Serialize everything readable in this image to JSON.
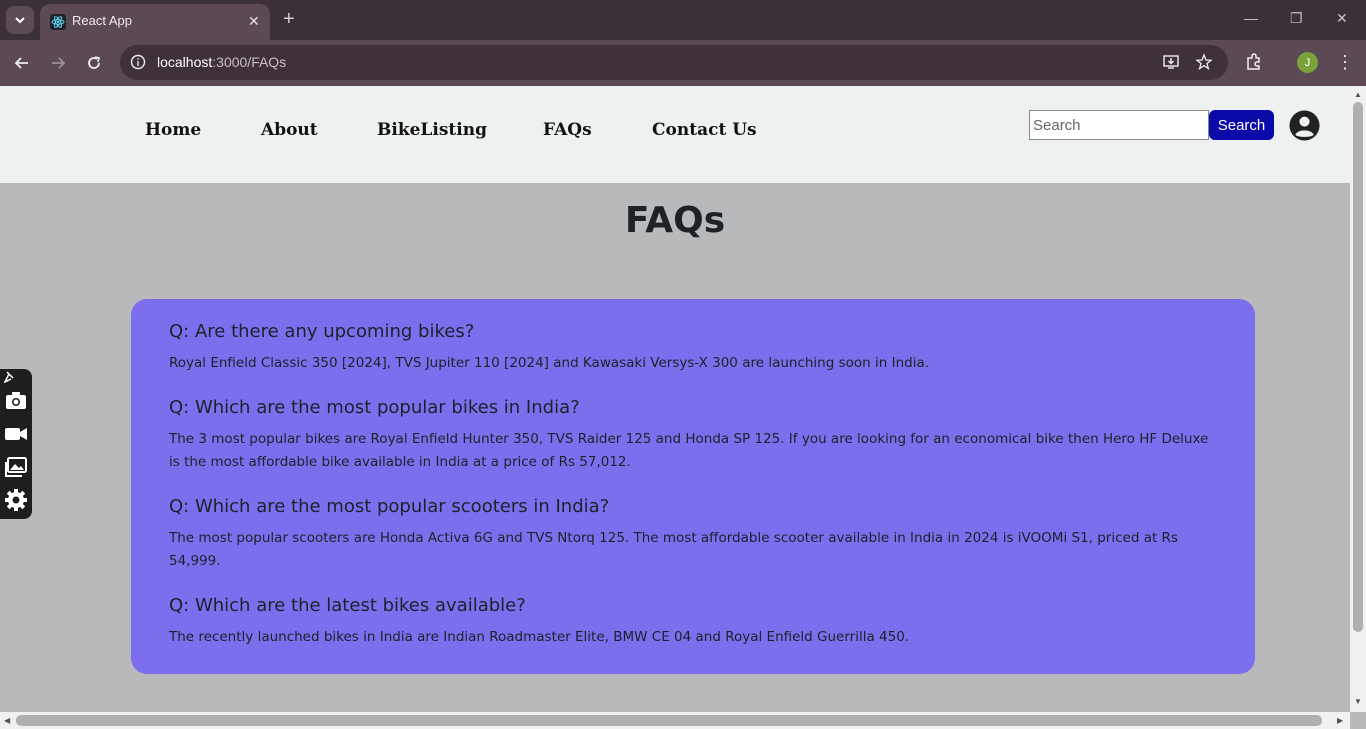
{
  "browser": {
    "tab_title": "React App",
    "url_host": "localhost",
    "url_path": ":3000/FAQs",
    "profile_initial": "J"
  },
  "navbar": {
    "links": [
      "Home",
      "About",
      "BikeListing",
      "FAQs",
      "Contact Us"
    ],
    "search_placeholder": "Search",
    "search_button": "Search"
  },
  "page": {
    "title": "FAQs",
    "faqs": [
      {
        "q": "Q: Are there any upcoming bikes?",
        "a": "Royal Enfield Classic 350 [2024], TVS Jupiter 110 [2024] and Kawasaki Versys-X 300 are launching soon in India."
      },
      {
        "q": "Q: Which are the most popular bikes in India?",
        "a": "The 3 most popular bikes are Royal Enfield Hunter 350, TVS Raider 125 and Honda SP 125. If you are looking for an economical bike then Hero HF Deluxe is the most affordable bike available in India at a price of Rs 57,012."
      },
      {
        "q": "Q: Which are the most popular scooters in India?",
        "a": "The most popular scooters are Honda Activa 6G and TVS Ntorq 125. The most affordable scooter available in India in 2024 is iVOOMi S1, priced at Rs 54,999."
      },
      {
        "q": "Q: Which are the latest bikes available?",
        "a": "The recently launched bikes in India are Indian Roadmaster Elite, BMW CE 04 and Royal Enfield Guerrilla 450."
      }
    ]
  },
  "colors": {
    "navbar_bg": "#edf2f0",
    "page_bg": "#b7b9ba",
    "card_bg": "#7b6fee",
    "search_button_bg": "#0a0aa8"
  }
}
